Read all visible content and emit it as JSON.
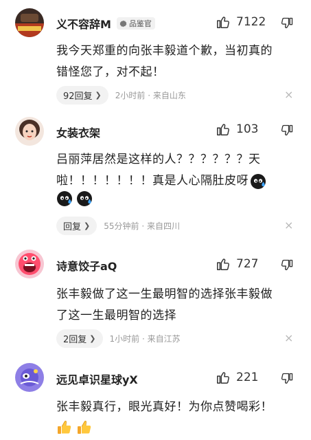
{
  "comments": [
    {
      "name": "义不容辞M",
      "badge": "品鉴官",
      "likes": "7122",
      "text_lines": [
        "我今天郑重的向张丰毅道个歉，当初真的",
        "错怪您了，对不起！"
      ],
      "reply_label": "92回复",
      "meta": "2小时前 · 来自山东"
    },
    {
      "name": "女装衣架",
      "likes": "103",
      "text_lines": [
        "吕丽萍居然是这样的人？？？？？？天",
        "啦！！！！！！！真是人心隔肚皮呀"
      ],
      "reply_label": "回复",
      "meta": "55分钟前 · 来自四川"
    },
    {
      "name": "诗意饺子aQ",
      "likes": "727",
      "text_lines": [
        "张丰毅做了这一生最明智的选择张丰毅做",
        "了这一生最明智的选择"
      ],
      "reply_label": "2回复",
      "meta": "1小时前 · 来自江苏"
    },
    {
      "name": "远见卓识星球yX",
      "likes": "221",
      "text_lines": [
        "张丰毅真行，眼光真好！为你点赞喝彩！"
      ],
      "emojis": [
        "thumbs-up",
        "thumbs-up"
      ]
    }
  ],
  "icons": {
    "like": "thumbs-up-outline-icon",
    "dislike": "thumbs-down-outline-icon",
    "close": "×",
    "chevron": "❯",
    "sweat_emoji": "sweat-face-emoji",
    "thumbs_emoji": "thumbs-up-emoji"
  },
  "colors": {
    "accent_badge_bg": "#f1f1f1",
    "meta_text": "#999999",
    "reply_bg": "#f2f2f2"
  }
}
